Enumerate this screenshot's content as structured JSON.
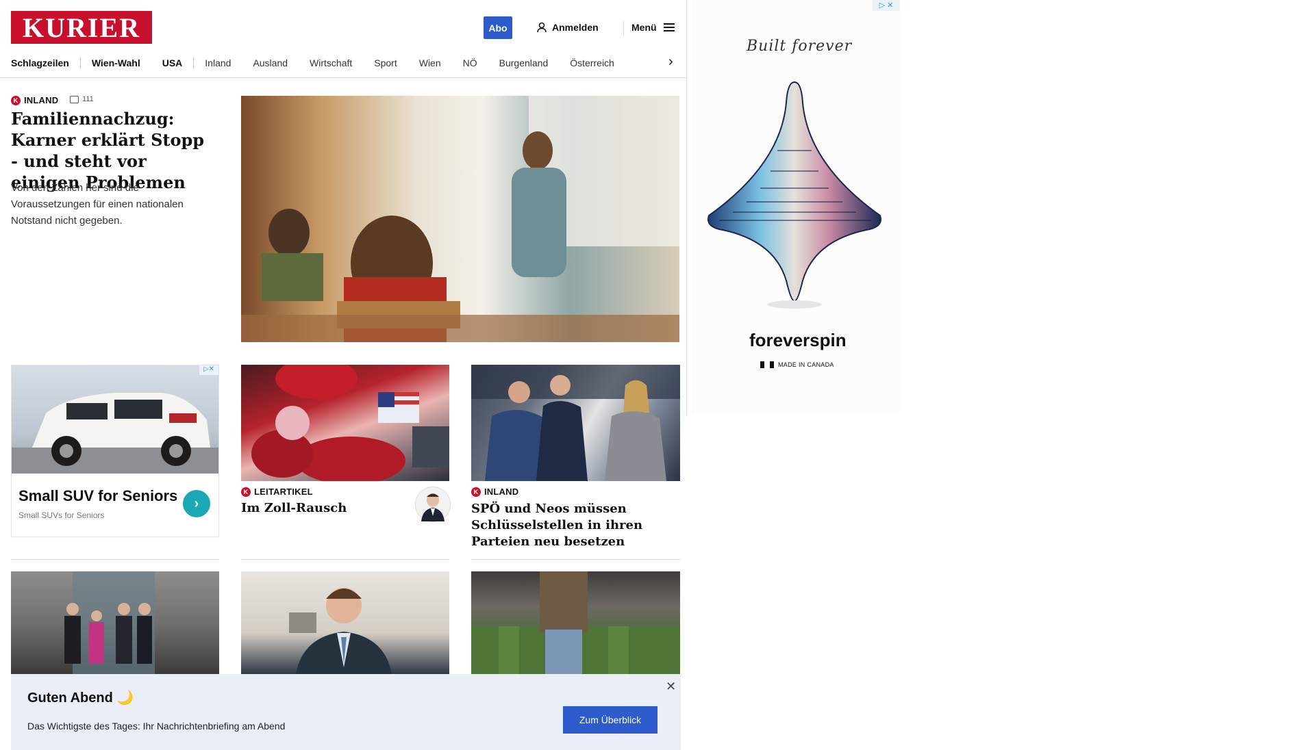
{
  "header": {
    "logo": "KURIER",
    "abo": "Abo",
    "login": "Anmelden",
    "menu": "Menü"
  },
  "nav": {
    "items": [
      "Schlagzeilen",
      "Wien-Wahl",
      "USA",
      "Inland",
      "Ausland",
      "Wirtschaft",
      "Sport",
      "Wien",
      "NÖ",
      "Burgenland",
      "Österreich"
    ]
  },
  "lead": {
    "category": "INLAND",
    "comments": "111",
    "title": "Familiennachzug: Karner erklärt Stopp - und steht vor einigen Problemen",
    "summary": "Von den Zahlen her sind die Voraussetzungen für einen nationalen Notstand nicht gegeben."
  },
  "ad_card": {
    "title": "Small SUV for Seniors",
    "subtitle": "Small SUVs for Seniors"
  },
  "cards": [
    {
      "category": "LEITARTIKEL",
      "title": "Im Zoll-Rausch"
    },
    {
      "category": "INLAND",
      "title": "SPÖ und Neos müssen Schlüsselstellen in ihren Parteien neu besetzen"
    }
  ],
  "banner": {
    "title": "Guten Abend 🌙",
    "text": "Das Wichtigste des Tages: Ihr Nachrichtenbriefing am Abend",
    "button": "Zum Überblick"
  },
  "side_ad": {
    "script": "Built forever",
    "brand": "foreverspin",
    "made_in": "MADE IN CANADA"
  },
  "colors": {
    "brand_red": "#c8102e",
    "accent_blue": "#2d5bcc",
    "banner_bg": "#e9eef7"
  }
}
